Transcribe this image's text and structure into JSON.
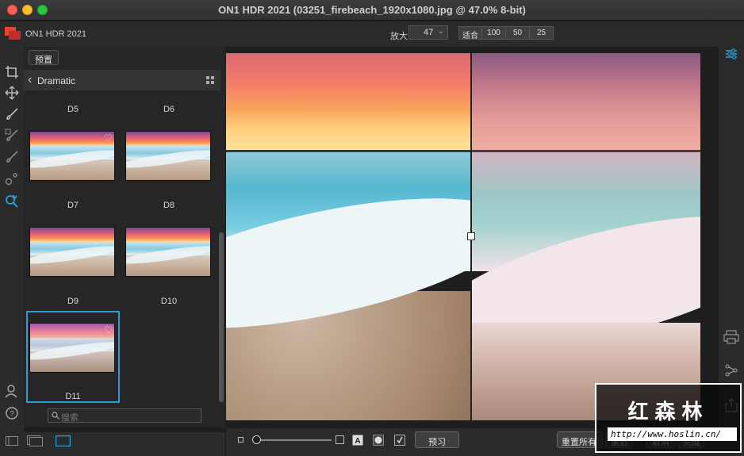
{
  "window": {
    "title": "ON1 HDR 2021 (03251_firebeach_1920x1080.jpg @ 47.0% 8-bit)"
  },
  "toolbar": {
    "app_name": "ON1 HDR 2021",
    "zoom_label": "放大",
    "zoom_value": "47",
    "zoom_options": [
      "适合",
      "100",
      "50",
      "25"
    ]
  },
  "panel": {
    "preset_button": "预置",
    "category": "Dramatic",
    "presets": [
      {
        "label": "D5"
      },
      {
        "label": "D6"
      },
      {
        "label": "D7"
      },
      {
        "label": "D8"
      },
      {
        "label": "D9"
      },
      {
        "label": "D10"
      },
      {
        "label": "D11"
      }
    ],
    "selected_preset": "D11",
    "search_placeholder": "搜索"
  },
  "bottom": {
    "preview_label": "预习",
    "reset_label": "重置所有",
    "btn2": "重启",
    "btn3": "取消",
    "btn4": "完成"
  },
  "watermark": {
    "title": "红森林",
    "url": "http://www.hoslin.cn/"
  },
  "colors": {
    "accent": "#2c9ed5",
    "selection_border": "#2c9ed5"
  }
}
